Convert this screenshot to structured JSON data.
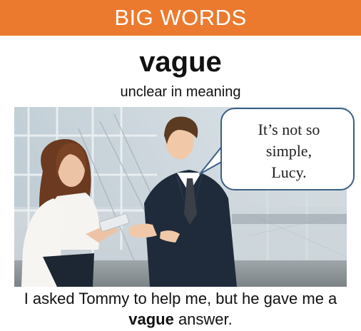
{
  "banner": {
    "title": "BIG WORDS",
    "color": "#ec7a2e"
  },
  "word": "vague",
  "definition": "unclear in meaning",
  "speech_bubble": {
    "line1": "It’s not so",
    "line2": "simple,",
    "line3": "Lucy."
  },
  "example": {
    "before": "I asked Tommy to help me, but he gave me a",
    "keyword": "vague",
    "after": " answer."
  },
  "photo": {
    "subject": "photo-business-conversation"
  }
}
